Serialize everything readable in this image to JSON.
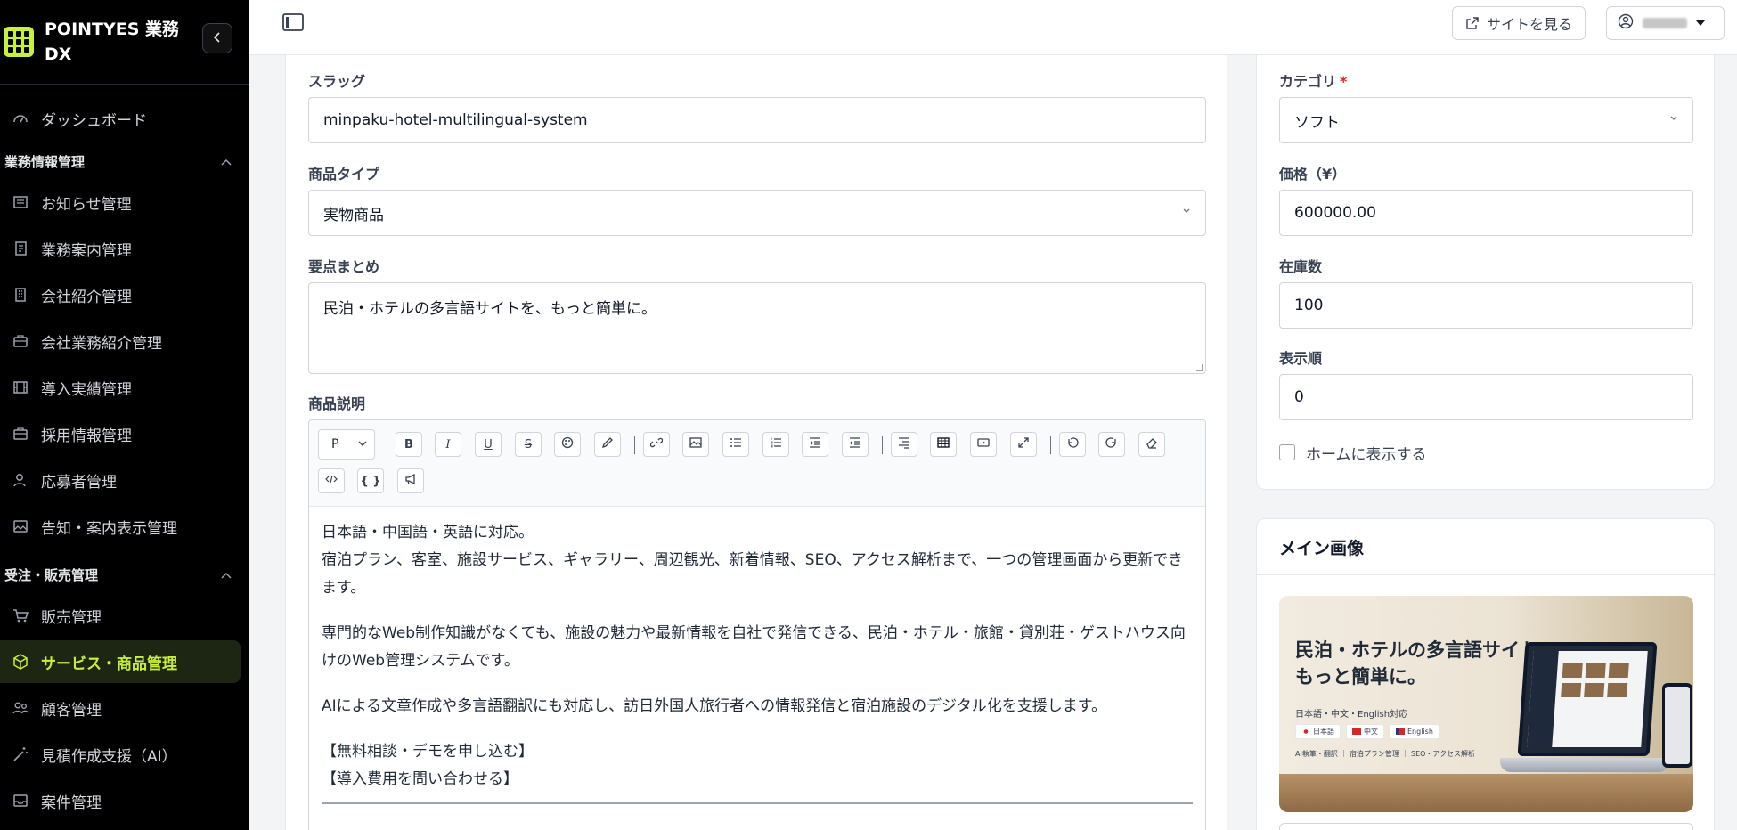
{
  "app": {
    "name": "POINTYES 業務DX",
    "collapse_icon": "chevron-left-icon"
  },
  "sidebar": {
    "top_items": [
      {
        "label": "ダッシュボード",
        "icon": "gauge-icon"
      }
    ],
    "sections": [
      {
        "title": "業務情報管理",
        "items": [
          {
            "label": "お知らせ管理",
            "icon": "newspaper-icon"
          },
          {
            "label": "業務案内管理",
            "icon": "document-icon"
          },
          {
            "label": "会社紹介管理",
            "icon": "building-icon"
          },
          {
            "label": "会社業務紹介管理",
            "icon": "briefcase-icon"
          },
          {
            "label": "導入実績管理",
            "icon": "film-icon"
          },
          {
            "label": "採用情報管理",
            "icon": "briefcase-icon"
          },
          {
            "label": "応募者管理",
            "icon": "user-icon"
          },
          {
            "label": "告知・案内表示管理",
            "icon": "image-icon"
          }
        ]
      },
      {
        "title": "受注・販売管理",
        "items": [
          {
            "label": "販売管理",
            "icon": "cart-icon"
          },
          {
            "label": "サービス・商品管理",
            "icon": "cube-icon",
            "active": true
          },
          {
            "label": "顧客管理",
            "icon": "users-icon"
          },
          {
            "label": "見積作成支援（AI）",
            "icon": "magic-wand-icon"
          },
          {
            "label": "案件管理",
            "icon": "inbox-icon"
          }
        ]
      }
    ]
  },
  "header": {
    "view_site_label": "サイトを見る",
    "user_name": "■■■■■"
  },
  "form": {
    "slug": {
      "label": "スラッグ",
      "value": "minpaku-hotel-multilingual-system"
    },
    "product_type": {
      "label": "商品タイプ",
      "value": "実物商品"
    },
    "summary": {
      "label": "要点まとめ",
      "value": "民泊・ホテルの多言語サイトを、もっと簡単に。"
    },
    "description": {
      "label": "商品説明",
      "format_value": "P",
      "paragraphs": [
        "日本語・中国語・英語に対応。\n宿泊プラン、客室、施設サービス、ギャラリー、周辺観光、新着情報、SEO、アクセス解析まで、一つの管理画面から更新できます。",
        "専門的なWeb制作知識がなくても、施設の魅力や最新情報を自社で発信できる、民泊・ホテル・旅館・貸別荘・ゲストハウス向けのWeb管理システムです。",
        "AIによる文章作成や多言語翻訳にも対応し、訪日外国人旅行者への情報発信と宿泊施設のデジタル化を支援します。",
        "【無料相談・デモを申し込む】\n【導入費用を問い合わせる】"
      ]
    },
    "category": {
      "label": "カテゴリ",
      "required_mark": "*",
      "value": "ソフト"
    },
    "price": {
      "label": "価格（¥）",
      "value": "600000.00"
    },
    "stock": {
      "label": "在庫数",
      "value": "100"
    },
    "order": {
      "label": "表示順",
      "value": "0"
    },
    "show_home": {
      "label": "ホームに表示する",
      "checked": false
    }
  },
  "main_image": {
    "title": "メイン画像",
    "hero": {
      "headline_1": "民泊・ホテルの多言語サイト",
      "headline_2": "もっと簡単に。",
      "subline": "日本語・中文・English対応",
      "flags": [
        "日本語",
        "中文",
        "English"
      ],
      "features": "AI執筆・翻訳 ｜ 宿泊プラン管理 ｜ SEO・アクセス解析"
    }
  }
}
